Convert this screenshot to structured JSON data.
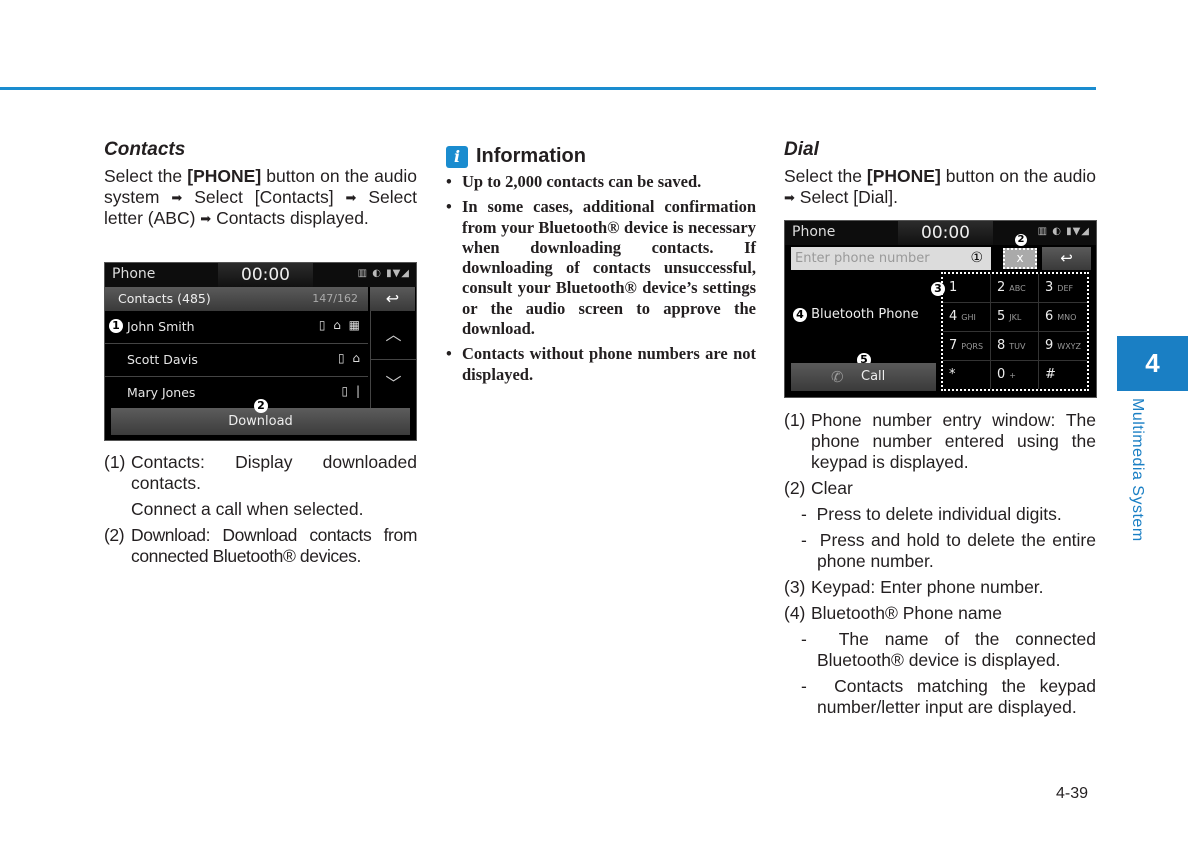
{
  "colors": {
    "accent": "#1a8ccf",
    "tab": "#1a7fc4"
  },
  "contacts": {
    "heading": "Contacts",
    "intro_parts": [
      "Select the ",
      "[PHONE]",
      " button on the audio system ",
      "Select [Contacts] ",
      "Select letter (ABC) ",
      "Contacts displayed."
    ],
    "arrow": "➡",
    "screen": {
      "app": "Phone",
      "clock": "00:00",
      "status_icons": "▥ ◐ ▮▼◢",
      "list_title": "Contacts (485)",
      "list_count": "147/162",
      "back_icon": "↩",
      "rows": [
        {
          "badge": "1",
          "name": "John Smith",
          "icons": "▯ ⌂ ▦"
        },
        {
          "badge": "",
          "name": "Scott Davis",
          "icons": "▯ ⌂"
        },
        {
          "badge": "",
          "name": "Mary Jones",
          "icons": "▯ |"
        }
      ],
      "scroll_up": "︿",
      "scroll_down": "﹀",
      "download_badge": "2",
      "download_label": "Download"
    },
    "notes": [
      {
        "num": "(1)",
        "text": "Contacts: Display downloaded contacts."
      },
      {
        "num": "",
        "text": "Connect a call when selected."
      },
      {
        "num": "(2)",
        "text": "Download: Download contacts from connected Bluetooth® devices."
      }
    ]
  },
  "information": {
    "icon": "i",
    "title": "Information",
    "bullets": [
      "Up to 2,000 contacts can be saved.",
      "In some cases, additional confirmation from your Bluetooth® device is necessary when downloading contacts. If downloading of contacts unsuccessful, consult your Bluetooth® device’s settings or the audio screen to approve the download.",
      "Contacts without phone numbers are not displayed."
    ]
  },
  "dial": {
    "heading": "Dial",
    "intro_parts": [
      "Select the ",
      "[PHONE]",
      " button on the audio ",
      "Select [Dial]."
    ],
    "screen": {
      "app": "Phone",
      "clock": "00:00",
      "status_icons": "▥ ◐ ▮▼◢",
      "input_placeholder": "Enter phone number",
      "badge_1": "①",
      "badge_2": "2",
      "clear_label": "x",
      "back_icon": "↩",
      "badge_3": "3",
      "badge_4": "4",
      "bt_name": "Bluetooth Phone",
      "badge_5": "5",
      "call_icon": "✆",
      "call_label": "Call",
      "keys": [
        {
          "d": "1",
          "l": ""
        },
        {
          "d": "2",
          "l": "ABC"
        },
        {
          "d": "3",
          "l": "DEF"
        },
        {
          "d": "4",
          "l": "GHI"
        },
        {
          "d": "5",
          "l": "JKL"
        },
        {
          "d": "6",
          "l": "MNO"
        },
        {
          "d": "7",
          "l": "PQRS"
        },
        {
          "d": "8",
          "l": "TUV"
        },
        {
          "d": "9",
          "l": "WXYZ"
        },
        {
          "d": "*",
          "l": ""
        },
        {
          "d": "0",
          "l": "+"
        },
        {
          "d": "#",
          "l": ""
        }
      ]
    },
    "notes": {
      "n1_num": "(1)",
      "n1_text": "Phone number entry window: The phone number entered using the keypad is displayed.",
      "n2_num": "(2)",
      "n2_text": "Clear",
      "n2_dashes": [
        "Press to delete individual digits.",
        "Press and hold to delete the entire phone number."
      ],
      "n3_num": "(3)",
      "n3_text": "Keypad: Enter phone number.",
      "n4_num": "(4)",
      "n4_text": "Bluetooth® Phone name",
      "n4_dashes": [
        "The name of the connected Bluetooth® device is displayed.",
        "Contacts matching the keypad number/letter input are displayed."
      ]
    }
  },
  "side_tab": {
    "number": "4",
    "label": "Multimedia System"
  },
  "page_number": "4-39"
}
